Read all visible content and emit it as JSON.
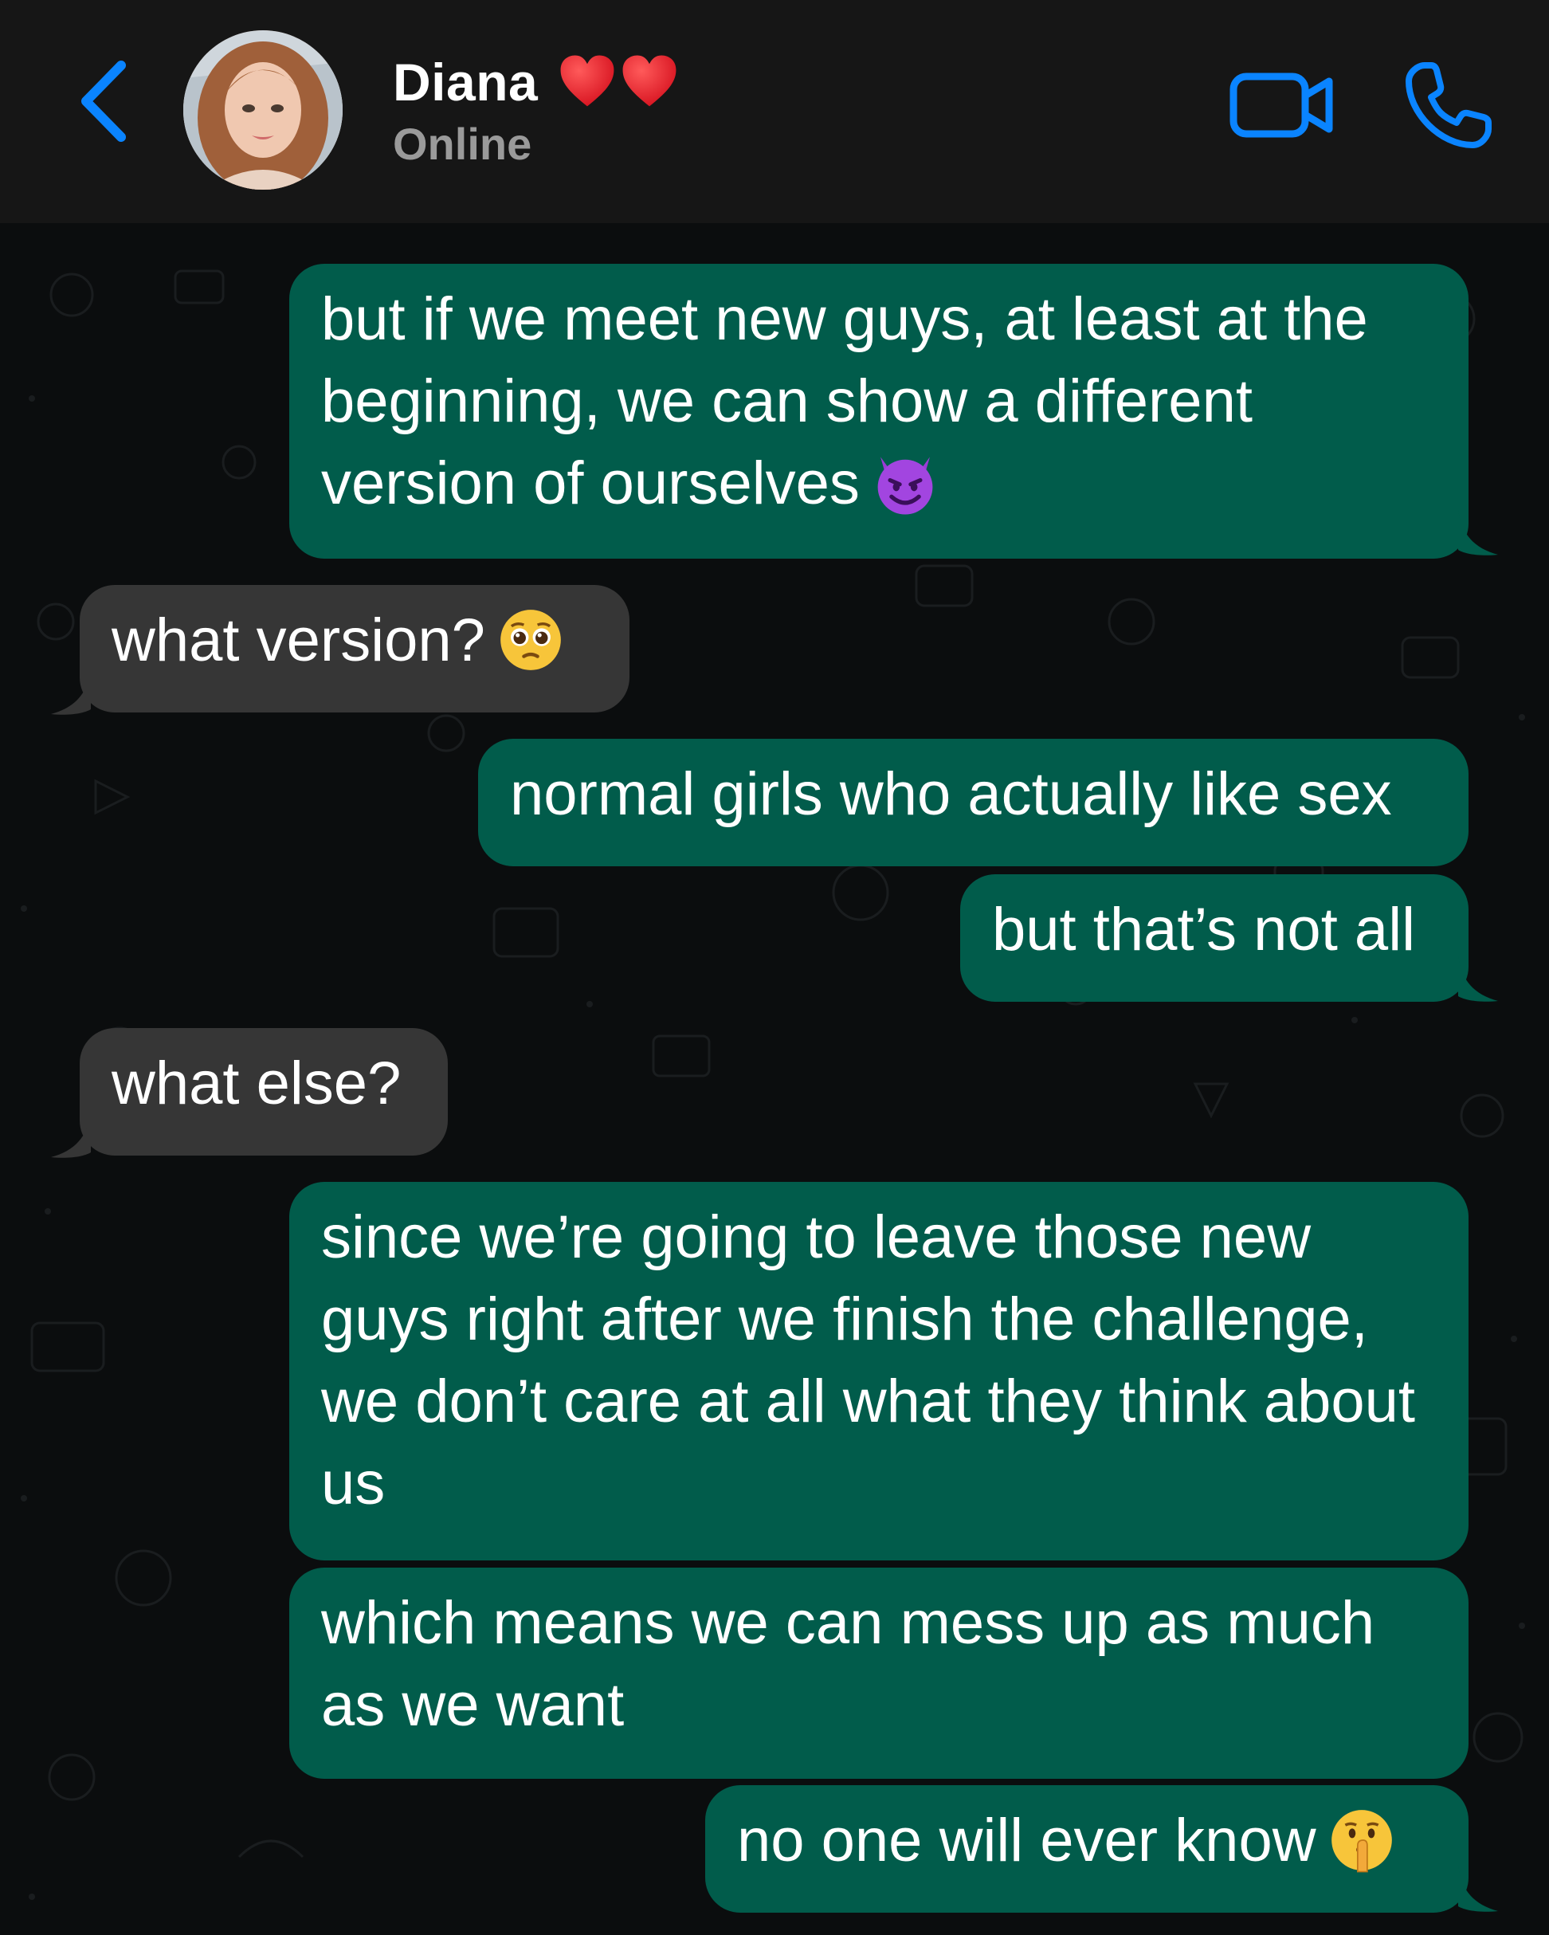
{
  "header": {
    "back_icon": "chevron-left-icon",
    "contact_name": "Diana",
    "name_emoji": [
      "heart-emoji",
      "heart-emoji"
    ],
    "status": "Online",
    "video_icon": "video-camera-icon",
    "call_icon": "phone-icon"
  },
  "colors": {
    "header_bg": "#161616",
    "chat_bg": "#0b0d0e",
    "outgoing_bubble": "#015c4b",
    "incoming_bubble": "#363636",
    "accent_blue": "#0a84ff",
    "status_gray": "#9a9a9a"
  },
  "messages": [
    {
      "direction": "outgoing",
      "text": "but if we meet new guys, at least at the beginning, we can show a different version of ourselves",
      "emoji": "smiling-devil-emoji"
    },
    {
      "direction": "incoming",
      "text": "what version?",
      "emoji": "pleading-face-emoji"
    },
    {
      "direction": "outgoing",
      "text": "normal girls who actually like sex"
    },
    {
      "direction": "outgoing",
      "text": "but that’s not all"
    },
    {
      "direction": "incoming",
      "text": "what else?"
    },
    {
      "direction": "outgoing",
      "text": "since we’re going to leave those new guys right after we finish the challenge, we don’t care at all what they think about us"
    },
    {
      "direction": "outgoing",
      "text": "which means we can mess up as much as we want"
    },
    {
      "direction": "outgoing",
      "text": "no one will ever know",
      "emoji": "shushing-face-emoji"
    }
  ]
}
